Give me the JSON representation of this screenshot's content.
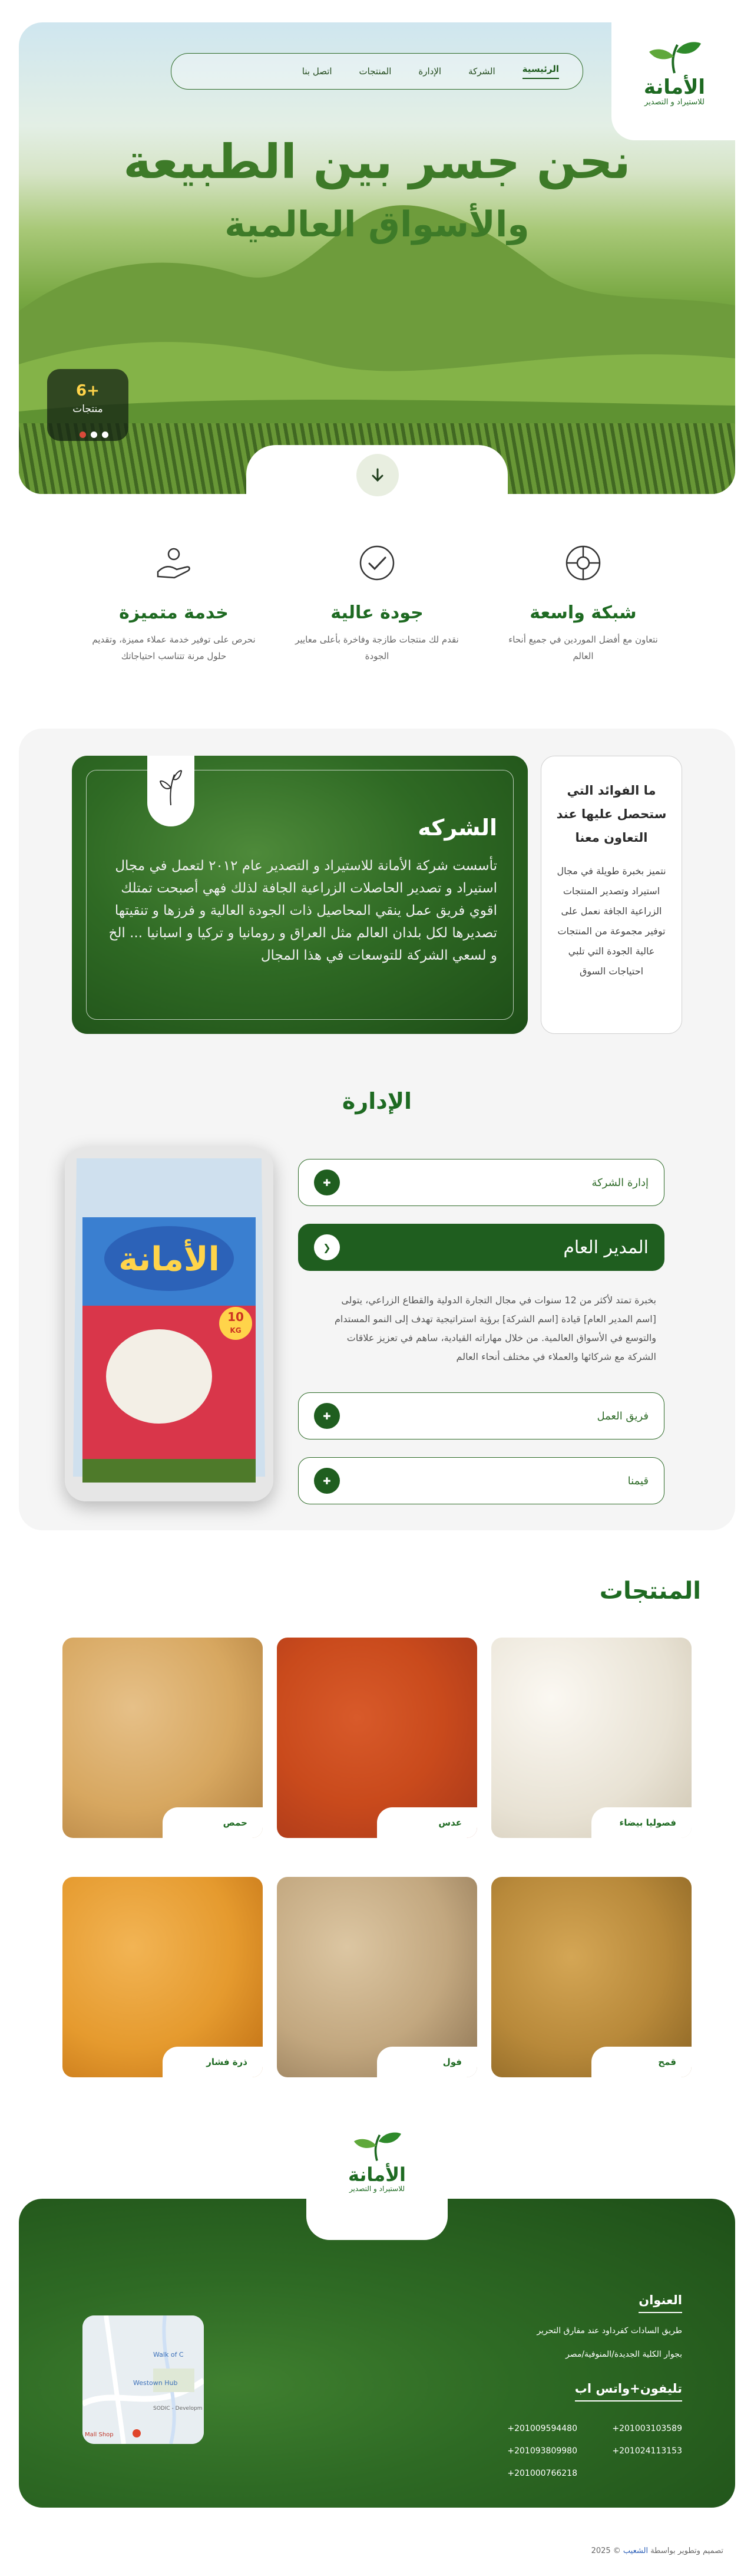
{
  "brand": {
    "name": "الأمانة",
    "tagline": "للاستيراد و التصدير",
    "accent": "#1e6a22",
    "dark_green": "#1f5e1f",
    "gold": "#ffd44a"
  },
  "nav": {
    "items": [
      {
        "label": "الرئيسية",
        "active": true
      },
      {
        "label": "الشركة"
      },
      {
        "label": "الإدارة"
      },
      {
        "label": "المنتجات"
      },
      {
        "label": "اتصل بنا"
      }
    ]
  },
  "hero": {
    "title_line1": "نحن جسر بين الطبيعة",
    "title_line2": "والأسواق العالمية",
    "counter_value": "6+",
    "counter_label": "منتجات",
    "scroll_icon": "arrow-down-icon"
  },
  "features": [
    {
      "icon": "network-icon",
      "title": "شبكة واسعة",
      "text": "نتعاون مع أفضل الموردين في جميع أنحاء العالم"
    },
    {
      "icon": "check-circle-icon",
      "title": "جودة عالية",
      "text": "نقدم لك منتجات طازجة وفاخرة بأعلى معايير الجودة"
    },
    {
      "icon": "service-hand-icon",
      "title": "خدمة متميزة",
      "text": "نحرص على توفير خدمة عملاء مميزة، وتقديم حلول مرنة تتناسب احتياجاتك"
    }
  ],
  "benefits": {
    "title": "ما الفوائد التي ستحصل عليها عند التعاون معنا",
    "text": "نتميز بخبرة طويلة في مجال استيراد وتصدير المنتجات الزراعية الجافة نعمل على توفير مجموعة من المنتجات عالية الجودة التي تلبي احتياجات السوق"
  },
  "company": {
    "title": "الشركه",
    "text": "تأسست شركة الأمانة للاستيراد و التصدير عام ٢٠١٢ لتعمل في مجال استيراد و تصدير الحاصلات الزراعية الجافة لذلك فهي أصبحت تمتلك اقوي فريق عمل ينقي المحاصيل ذات الجودة العالية و فرزها و تنقيتها تصديرها لكل بلدان العالم مثل العراق و رومانيا و تركيا و اسبانيا ... الخ و لسعي الشركة للتوسعات في هذا المجال"
  },
  "management": {
    "title": "الإدارة",
    "items": [
      {
        "label": "إدارة الشركة",
        "icon": "plus-icon"
      },
      {
        "label": "المدير العام",
        "icon": "chevron-right-icon",
        "open": true
      },
      {
        "label": "فريق العمل",
        "icon": "plus-icon"
      },
      {
        "label": "قيمنا",
        "icon": "plus-icon"
      }
    ],
    "open_text": "بخبرة تمتد لأكثر من 12 سنوات في مجال التجارة الدولية والقطاع الزراعي، يتولى [اسم المدير العام] قيادة [اسم الشركة] برؤية استراتيجية تهدف إلى النمو المستدام والتوسع في الأسواق العالمية. من خلال مهاراته القيادية، ساهم في تعزيز علاقات الشركة مع شركائها والعملاء في مختلف أنحاء العالم",
    "bag": {
      "brand": "الأمانة",
      "weight": "10",
      "unit": "KG"
    }
  },
  "products": {
    "title": "المنتجات",
    "items": [
      {
        "name": "فصوليا بيضاء",
        "color": "#f0ece3"
      },
      {
        "name": "عدس",
        "color": "#c94a1c"
      },
      {
        "name": "حمص",
        "color": "#d7a760"
      },
      {
        "name": "قمح",
        "color": "#b8893a"
      },
      {
        "name": "فول",
        "color": "#c2a77f"
      },
      {
        "name": "ذرة فشار",
        "color": "#e59a2e"
      }
    ]
  },
  "footer": {
    "address_title": "العنوان",
    "address_line1": "طريق السادات كفرداود عند مفارق التحرير",
    "address_line2": "بجوار الكلية الجديدة/المنوفية/مصر",
    "phone_title": "تليفون+واتس اب",
    "phones": [
      "+201003103589",
      "+201009594480",
      "+201024113153",
      "+201093809980",
      "+201000766218"
    ],
    "map_labels": [
      "Walk of C",
      "Westown Hub",
      "SODIC - Developm",
      "Mall Shop"
    ],
    "copyright": "2025 © تصميم وتطوير بواسطة",
    "copyright_brand": "الشعيب"
  }
}
